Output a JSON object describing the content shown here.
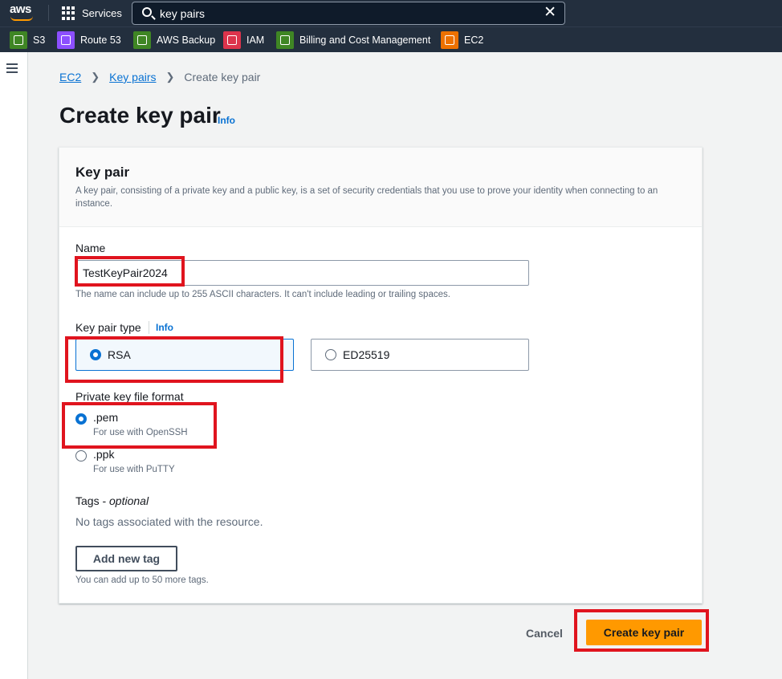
{
  "colors": {
    "accent": "#0972d3",
    "primary_button": "#ff9900",
    "highlight": "#e0141e",
    "nav_bg": "#232f3e"
  },
  "nav": {
    "services_label": "Services",
    "search_value": "key pairs",
    "favorites": [
      {
        "label": "S3",
        "color": "#3f8624"
      },
      {
        "label": "Route 53",
        "color": "#8c4fff"
      },
      {
        "label": "AWS Backup",
        "color": "#3f8624"
      },
      {
        "label": "IAM",
        "color": "#dd344c"
      },
      {
        "label": "Billing and Cost Management",
        "color": "#3f8624"
      },
      {
        "label": "EC2",
        "color": "#ed7100"
      }
    ]
  },
  "breadcrumb": {
    "items": [
      "EC2",
      "Key pairs"
    ],
    "current": "Create key pair"
  },
  "page": {
    "title": "Create key pair",
    "info": "Info"
  },
  "panel": {
    "title": "Key pair",
    "description": "A key pair, consisting of a private key and a public key, is a set of security credentials that you use to prove your identity when connecting to an instance."
  },
  "name_field": {
    "label": "Name",
    "value": "TestKeyPair2024",
    "hint": "The name can include up to 255 ASCII characters. It can't include leading or trailing spaces."
  },
  "key_pair_type": {
    "label": "Key pair type",
    "info": "Info",
    "options": [
      "RSA",
      "ED25519"
    ],
    "selected": "RSA"
  },
  "file_format": {
    "label": "Private key file format",
    "options": [
      {
        "value": ".pem",
        "desc": "For use with OpenSSH"
      },
      {
        "value": ".ppk",
        "desc": "For use with PuTTY"
      }
    ],
    "selected": ".pem"
  },
  "tags": {
    "label": "Tags - ",
    "label_optional": "optional",
    "empty": "No tags associated with the resource.",
    "add_button": "Add new tag",
    "hint": "You can add up to 50 more tags."
  },
  "actions": {
    "cancel": "Cancel",
    "create": "Create key pair"
  }
}
